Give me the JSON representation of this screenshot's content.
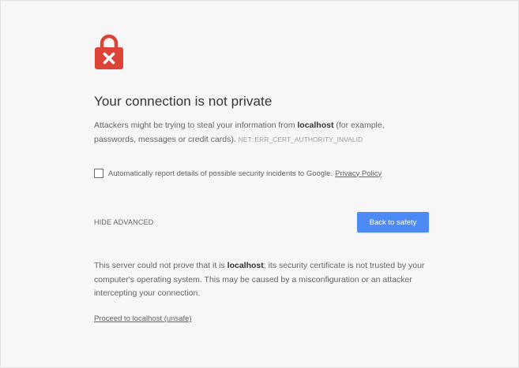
{
  "lock_icon": {
    "name": "lock-warning-icon",
    "color": "#db4437",
    "mark_color": "#ffffff"
  },
  "heading": "Your connection is not private",
  "description": {
    "prefix": "Attackers might be trying to steal your information from ",
    "host": "localhost",
    "suffix": " (for example, passwords, messages or credit cards).",
    "error_code": "NET::ERR_CERT_AUTHORITY_INVALID"
  },
  "report": {
    "checked": false,
    "label": "Automatically report details of possible security incidents to Google.",
    "policy_link": "Privacy Policy"
  },
  "hide_advanced_label": "HIDE ADVANCED",
  "back_button_label": "Back to safety",
  "back_button_color": "#4c8bf5",
  "details": {
    "prefix": "This server could not prove that it is ",
    "host": "localhost",
    "suffix": "; its security certificate is not trusted by your computer's operating system. This may be caused by a misconfiguration or an attacker intercepting your connection."
  },
  "proceed_link": "Proceed to localhost (unsafe)"
}
